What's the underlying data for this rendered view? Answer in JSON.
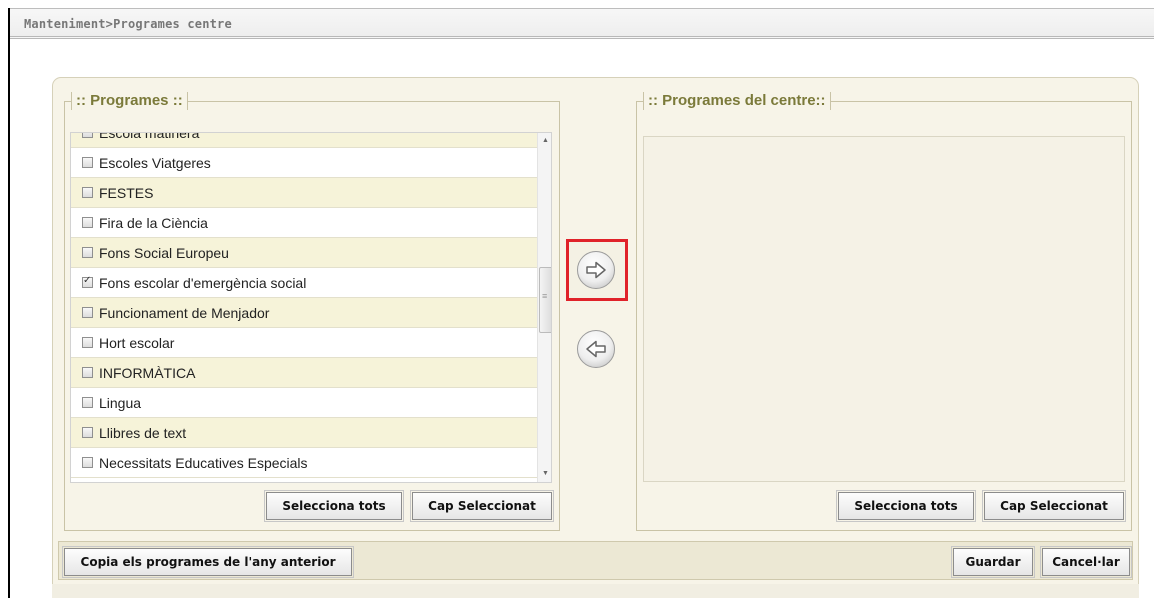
{
  "breadcrumb": "Manteniment>Programes centre",
  "programs_panel": {
    "legend": ":: Programes ::",
    "items": [
      {
        "label": "Escola matinera",
        "checked": false
      },
      {
        "label": "Escoles Viatgeres",
        "checked": false
      },
      {
        "label": "FESTES",
        "checked": false
      },
      {
        "label": "Fira de la Ciència",
        "checked": false
      },
      {
        "label": "Fons Social Europeu",
        "checked": false
      },
      {
        "label": "Fons escolar d'emergència social",
        "checked": true
      },
      {
        "label": "Funcionament de Menjador",
        "checked": false
      },
      {
        "label": "Hort escolar",
        "checked": false
      },
      {
        "label": "INFORMÀTICA",
        "checked": false
      },
      {
        "label": "Lingua",
        "checked": false
      },
      {
        "label": "Llibres de text",
        "checked": false
      },
      {
        "label": "Necessitats Educatives Especials",
        "checked": false
      }
    ],
    "select_all": "Selecciona tots",
    "select_none": "Cap Seleccionat"
  },
  "center_panel": {
    "legend": ":: Programes del centre::",
    "select_all": "Selecciona tots",
    "select_none": "Cap Seleccionat"
  },
  "actions": {
    "copy_previous": "Copia els programes de l'any anterior",
    "save": "Guardar",
    "cancel": "Cancel·lar"
  },
  "icons": {
    "move_right": "arrow-right-icon",
    "move_left": "arrow-left-icon"
  },
  "colors": {
    "legend_text": "#7b7a3a",
    "panel_bg": "#f7f4e8",
    "row_alt": "#f6f3d9",
    "highlight": "#e0222a"
  }
}
